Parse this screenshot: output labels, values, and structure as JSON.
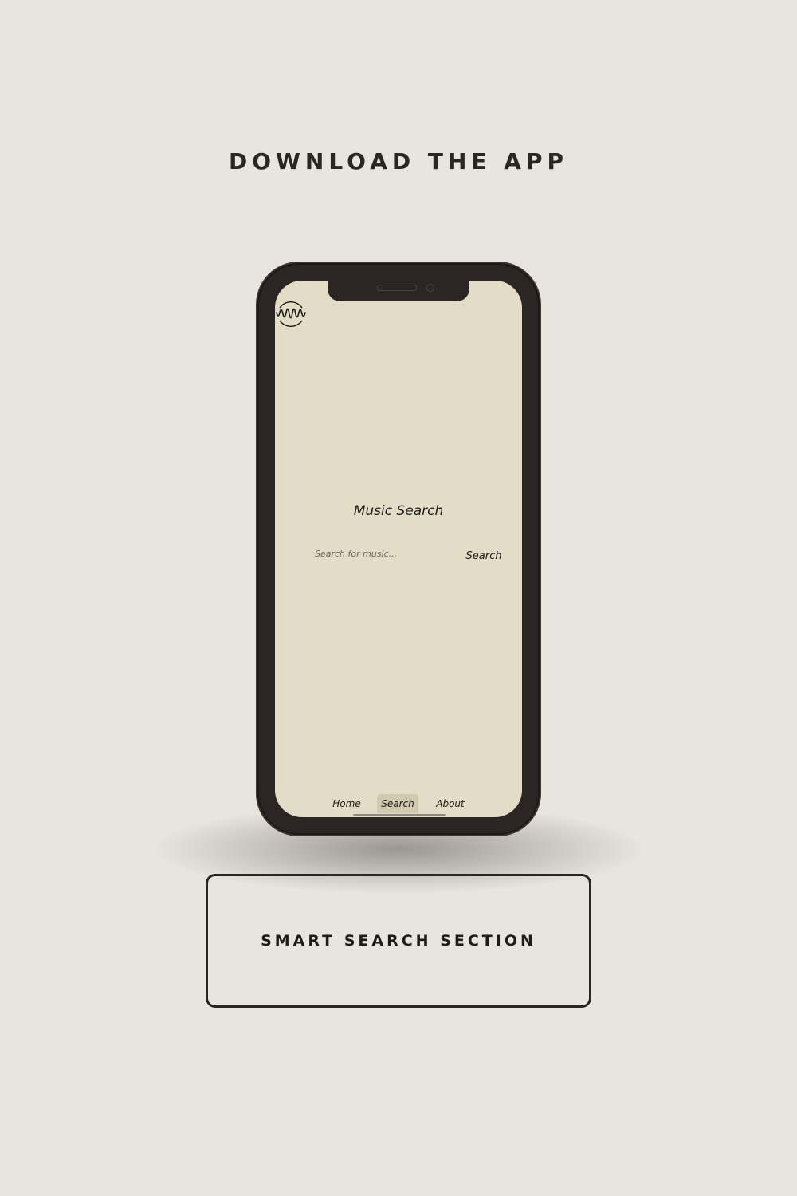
{
  "page": {
    "headline": "DOWNLOAD THE APP",
    "section_label": "SMART SEARCH SECTION"
  },
  "app": {
    "logo_icon": "waveform-circle-icon",
    "title": "Music Search",
    "search": {
      "placeholder": "Search for music...",
      "value": "",
      "button_label": "Search"
    },
    "tabs": [
      {
        "label": "Home",
        "active": false
      },
      {
        "label": "Search",
        "active": true
      },
      {
        "label": "About",
        "active": false
      }
    ]
  },
  "colors": {
    "page_background": "#e8e5de",
    "phone_frame": "#2b2624",
    "app_background": "#e3dcc6",
    "active_tab": "#d2c9b1",
    "text": "#2a2624"
  }
}
